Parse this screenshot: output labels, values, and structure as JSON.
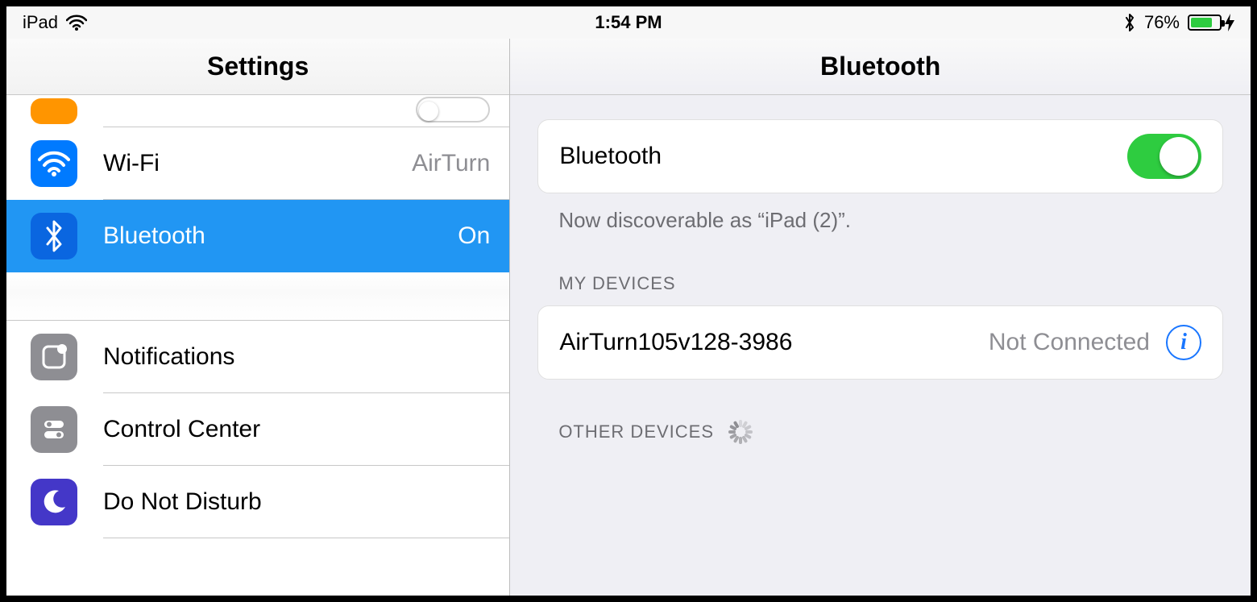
{
  "status_bar": {
    "carrier": "iPad",
    "time": "1:54 PM",
    "battery_percent": "76%"
  },
  "left": {
    "title": "Settings",
    "rows": {
      "wifi": {
        "label": "Wi-Fi",
        "value": "AirTurn"
      },
      "bluetooth": {
        "label": "Bluetooth",
        "value": "On"
      },
      "notifications": {
        "label": "Notifications"
      },
      "control_center": {
        "label": "Control Center"
      },
      "dnd": {
        "label": "Do Not Disturb"
      }
    }
  },
  "right": {
    "title": "Bluetooth",
    "toggle_label": "Bluetooth",
    "discoverable_note": "Now discoverable as “iPad (2)”.",
    "my_devices_label": "MY DEVICES",
    "devices": [
      {
        "name": "AirTurn105v128-3986",
        "status": "Not Connected"
      }
    ],
    "other_devices_label": "OTHER DEVICES"
  }
}
